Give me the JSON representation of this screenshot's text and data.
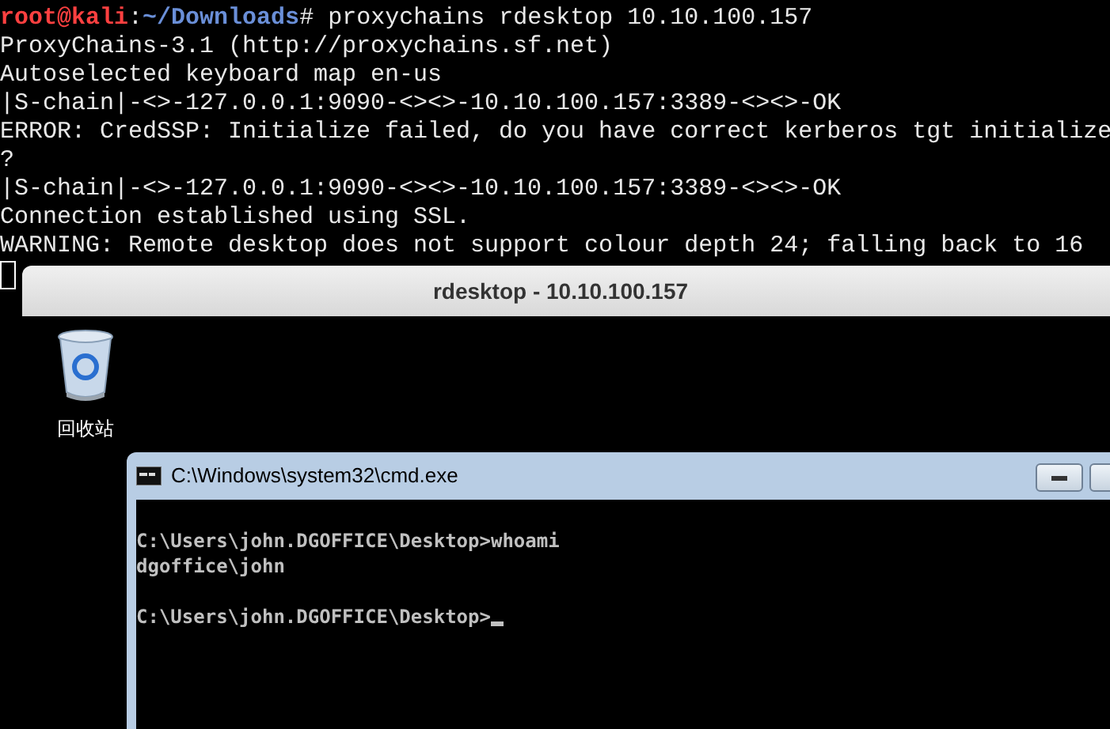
{
  "terminal": {
    "prompt": {
      "user_host": "root@kali",
      "separator": ":",
      "path": "~/Downloads",
      "symbol": "#",
      "command": " proxychains rdesktop 10.10.100.157"
    },
    "lines": [
      "ProxyChains-3.1 (http://proxychains.sf.net)",
      "Autoselected keyboard map en-us",
      "|S-chain|-<>-127.0.0.1:9090-<><>-10.10.100.157:3389-<><>-OK",
      "ERROR: CredSSP: Initialize failed, do you have correct kerberos tgt initialize",
      "?",
      "|S-chain|-<>-127.0.0.1:9090-<><>-10.10.100.157:3389-<><>-OK",
      "Connection established using SSL.",
      "WARNING: Remote desktop does not support colour depth 24; falling back to 16"
    ]
  },
  "rdesktop_window": {
    "title": "rdesktop - 10.10.100.157",
    "desktop_icons": [
      {
        "label": "回收站"
      }
    ],
    "cmd_window": {
      "title": "C:\\Windows\\system32\\cmd.exe",
      "lines": [
        {
          "text": "C:\\Users\\john.DGOFFICE\\Desktop>whoami",
          "blank_before": true,
          "cursor": false
        },
        {
          "text": "dgoffice\\john",
          "blank_before": false,
          "cursor": false
        },
        {
          "text": "C:\\Users\\john.DGOFFICE\\Desktop>",
          "blank_before": true,
          "cursor": true
        }
      ]
    }
  }
}
